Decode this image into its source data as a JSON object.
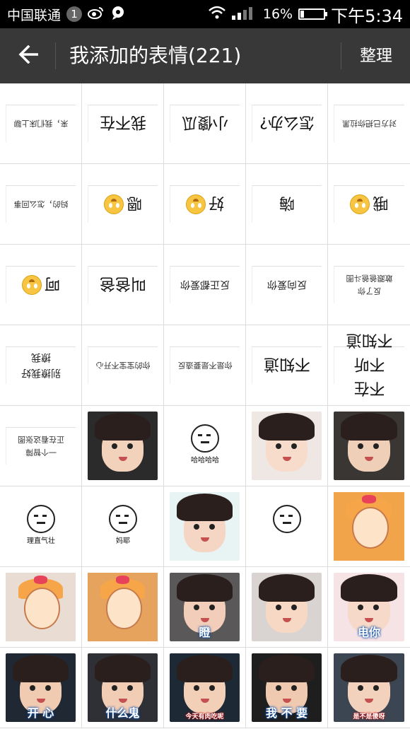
{
  "status_bar": {
    "carrier": "中国联通",
    "badge": "1",
    "battery": "16%",
    "battery_level": 0.16,
    "time": "下午5:34"
  },
  "header": {
    "back_icon": "back-arrow-icon",
    "title": "我添加的表情(221)",
    "action": "整理"
  },
  "stickers": [
    {
      "kind": "text",
      "size": "small",
      "text": "来，我们床上聊"
    },
    {
      "kind": "text",
      "size": "big",
      "text": "我不在"
    },
    {
      "kind": "text",
      "size": "big",
      "text": "小傻瓜"
    },
    {
      "kind": "text",
      "size": "big",
      "text": "怎么办?"
    },
    {
      "kind": "text",
      "size": "small",
      "text": "对方已把你拉黑"
    },
    {
      "kind": "text",
      "size": "small",
      "text": "妈的，怎么回事"
    },
    {
      "kind": "text",
      "size": "big",
      "text": "嗯",
      "emoji": true
    },
    {
      "kind": "text",
      "size": "big",
      "text": "好",
      "emoji": true
    },
    {
      "kind": "text",
      "size": "big",
      "text": "嗨"
    },
    {
      "kind": "text",
      "size": "big",
      "text": "哦",
      "emoji": true
    },
    {
      "kind": "text",
      "size": "big",
      "text": "呵",
      "emoji": true
    },
    {
      "kind": "text",
      "size": "big",
      "text": "叫爸爸"
    },
    {
      "kind": "text",
      "size": "med",
      "text": "反正都爱你"
    },
    {
      "kind": "text",
      "size": "med",
      "text": "反向爱你"
    },
    {
      "kind": "text",
      "size": "small",
      "wrap": true,
      "lines": [
        "反了你",
        "敢跟爸爸斗图"
      ]
    },
    {
      "kind": "text",
      "size": "med",
      "wrap": true,
      "lines": [
        "别撩我好",
        "撩我"
      ]
    },
    {
      "kind": "text",
      "size": "small",
      "text": "你的宝宝不开心"
    },
    {
      "kind": "text",
      "size": "small",
      "text": "你是不是要造反"
    },
    {
      "kind": "text",
      "size": "big",
      "text": "不知道"
    },
    {
      "kind": "text",
      "size": "big",
      "wrap": true,
      "lines": [
        "不在",
        "不听",
        "不知道"
      ]
    },
    {
      "kind": "text",
      "size": "small",
      "wrap": true,
      "lines": [
        "一个智障",
        "正在看这张图"
      ]
    },
    {
      "kind": "photo",
      "bg": "#2b2b2b",
      "skin": "#f3d2bc"
    },
    {
      "kind": "meme",
      "label": "哈哈哈哈"
    },
    {
      "kind": "photo",
      "bg": "#efe7e3",
      "skin": "#f7dccb"
    },
    {
      "kind": "photo",
      "bg": "#3a3634",
      "skin": "#f0cfb8"
    },
    {
      "kind": "meme",
      "label": "理直气壮"
    },
    {
      "kind": "meme",
      "label": "妈耶"
    },
    {
      "kind": "photo",
      "bg": "#e8f3f3",
      "skin": "#f5d6c4"
    },
    {
      "kind": "meme",
      "label": ""
    },
    {
      "kind": "cartoon",
      "bg": "#f2a44a"
    },
    {
      "kind": "cartoon",
      "bg": "#e9dcd2"
    },
    {
      "kind": "cartoon",
      "bg": "#e6a35d"
    },
    {
      "kind": "photo",
      "bg": "#5a5858",
      "skin": "#f2cdb9",
      "caption": "瞪"
    },
    {
      "kind": "photo",
      "bg": "#d9d4d1",
      "skin": "#f6d8c4"
    },
    {
      "kind": "photo",
      "bg": "#f6e3e6",
      "skin": "#f6d9c9",
      "caption": "电你"
    },
    {
      "kind": "photo",
      "bg": "#202833",
      "skin": "#f0cbb1",
      "caption": "开  心"
    },
    {
      "kind": "photo",
      "bg": "#2f2f36",
      "skin": "#f1cdb6",
      "caption": "什么鬼"
    },
    {
      "kind": "photo",
      "bg": "#1d2a36",
      "skin": "#f2cfb7",
      "caption": "今天有肉吃呢",
      "caption_small": true
    },
    {
      "kind": "photo",
      "bg": "#1e1e1e",
      "skin": "#efcab1",
      "caption": "我 不 要"
    },
    {
      "kind": "photo",
      "bg": "#3c4652",
      "skin": "#f3d2bd",
      "caption": "是不是傻呀",
      "caption_small": true
    }
  ]
}
